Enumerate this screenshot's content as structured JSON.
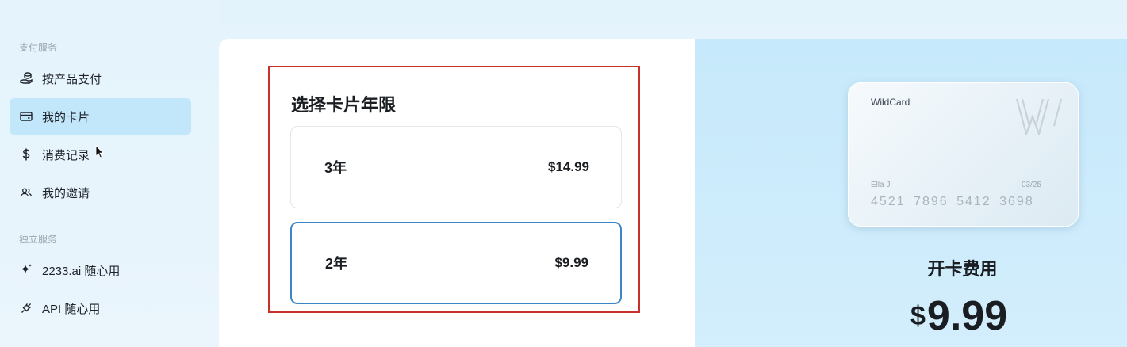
{
  "sidebar": {
    "sections": [
      {
        "title": "支付服务",
        "items": [
          {
            "label": "按产品支付",
            "icon": "coins-hand-icon",
            "active": false
          },
          {
            "label": "我的卡片",
            "icon": "credit-card-icon",
            "active": true
          },
          {
            "label": "消费记录",
            "icon": "dollar-icon",
            "active": false
          },
          {
            "label": "我的邀请",
            "icon": "users-icon",
            "active": false
          }
        ]
      },
      {
        "title": "独立服务",
        "items": [
          {
            "label": "2233.ai 随心用",
            "icon": "sparkle-icon",
            "active": false
          },
          {
            "label": "API 随心用",
            "icon": "plug-icon",
            "active": false
          }
        ]
      }
    ]
  },
  "selector": {
    "title": "选择卡片年限",
    "options": [
      {
        "label": "3年",
        "price": "$14.99",
        "selected": false
      },
      {
        "label": "2年",
        "price": "$9.99",
        "selected": true
      }
    ]
  },
  "card": {
    "brand": "WildCard",
    "holder": "Ella Ji",
    "expiry": "03/25",
    "number": "4521 7896 5412 3698"
  },
  "fee": {
    "label": "开卡费用",
    "currency": "$",
    "amount": "9.99"
  },
  "colors": {
    "accent": "#3a86c8",
    "active_nav": "#c2e6fa",
    "highlight_border": "#c8302b",
    "preview_bg": "#c6e9fb"
  }
}
